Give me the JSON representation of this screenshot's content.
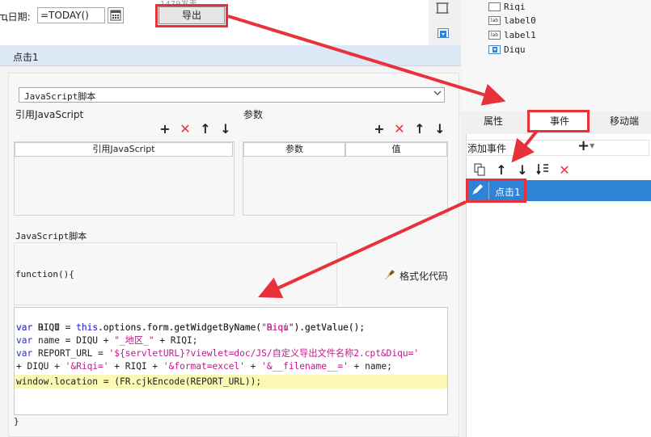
{
  "top": {
    "date_label": "ҵ日期:",
    "date_value": "=TODAY()",
    "export_ghost": "1479发表",
    "export_label": "导出"
  },
  "widgets": [
    {
      "icon": "calendar-widget-icon",
      "label": "Riqi"
    },
    {
      "icon": "label-widget-icon",
      "label": "label0"
    },
    {
      "icon": "label-widget-icon",
      "label": "label1"
    },
    {
      "icon": "combo-widget-icon",
      "label": "Diqu"
    }
  ],
  "dialog": {
    "title": "点击1",
    "type_select": "JavaScript脚本",
    "ref_js_label": "引用JavaScript",
    "params_label": "参数",
    "ref_js_header": "引用JavaScript",
    "param_header": "参数",
    "value_header": "值",
    "js_script_label": "JavaScript脚本",
    "function_open": "function(){",
    "format_label": "格式化代码",
    "function_close": "}"
  },
  "code_lines": [
    "var DIQU = this.options.form.getWidgetByName(\"Diqu\").getValue();",
    "var RIQI = this.options.form.getWidgetByName(\"Riqi\").getValue();",
    "var name = DIQU + \"_地区_\" + RIQI;",
    "var REPORT_URL = '${servletURL}?viewlet=doc/JS/自定义导出文件名称2.cpt&Diqu='",
    "+ DIQU + '&Riqi=' + RIQI + '&format=excel' + '&__filename__=' + name;",
    "window.location = (FR.cjkEncode(REPORT_URL));"
  ],
  "panel": {
    "tabs": [
      "属性",
      "事件",
      "移动端"
    ],
    "active_tab": "事件",
    "add_event_label": "添加事件",
    "event_item": "点击1"
  },
  "colors": {
    "accent_blue": "#2f83d6",
    "highlight_red": "#e8323a",
    "code_keyword": "#2b2bd8",
    "code_string": "#c4168a",
    "current_line": "#fbf7b4"
  }
}
